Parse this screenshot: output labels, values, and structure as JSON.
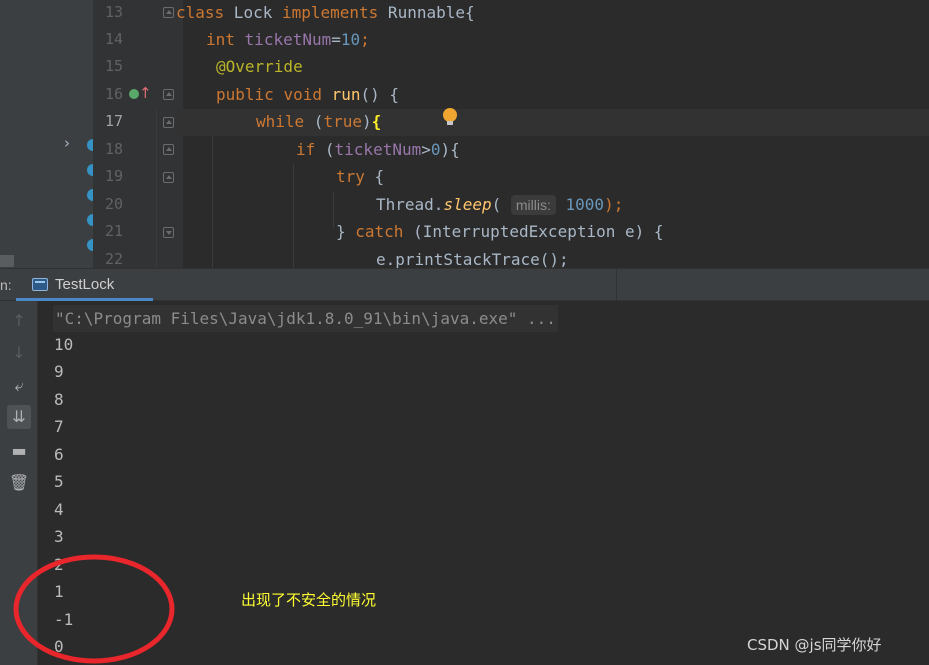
{
  "editor": {
    "line_numbers": [
      "13",
      "14",
      "15",
      "16",
      "17",
      "18",
      "19",
      "20",
      "21",
      "22"
    ],
    "active_line": "17",
    "code": {
      "l13": {
        "kw_class": "class",
        "class_name": " Lock ",
        "kw_implements": "implements",
        "iface": " Runnable{"
      },
      "l14": {
        "type": "int",
        "field": "ticketNum",
        "eq": "=",
        "value": "10",
        "semi": ";"
      },
      "l15": {
        "annotation": "@Override"
      },
      "l16": {
        "kw_public": "public",
        "kw_void": "void",
        "method": "run",
        "rest": "() {"
      },
      "l17": {
        "kw_while": "while",
        "open": " (",
        "kw_true": "true",
        "close": ")",
        "brace": "{"
      },
      "l18": {
        "kw_if": "if",
        "open": " (",
        "field": "ticketNum",
        "op": ">",
        "value": "0",
        "rest": "){"
      },
      "l19": {
        "kw_try": "try",
        "rest": " {"
      },
      "l20": {
        "cls": "Thread.",
        "method": "sleep",
        "open": "(",
        "hint": "millis:",
        "value": "1000",
        "rest": ");"
      },
      "l21": {
        "brace": "} ",
        "kw_catch": "catch",
        "rest": " (InterruptedException e) {"
      },
      "l22": {
        "text": "e.printStackTrace();"
      }
    }
  },
  "run_panel": {
    "label": "n:",
    "tab_label": "TestLock",
    "toolbar_icons": [
      "up-arrow-icon",
      "down-arrow-icon",
      "soft-wrap-icon",
      "scroll-to-end-icon",
      "print-icon",
      "trash-icon"
    ]
  },
  "console": {
    "command": "\"C:\\Program Files\\Java\\jdk1.8.0_91\\bin\\java.exe\" ...",
    "output": [
      "10",
      "9",
      "8",
      "7",
      "6",
      "5",
      "4",
      "3",
      "2",
      "1",
      "-1",
      "0"
    ]
  },
  "annotation": {
    "note": "出现了不安全的情况",
    "circle_color": "#e8262b",
    "note_color": "#ffff33"
  },
  "watermark": "CSDN @js同学你好"
}
